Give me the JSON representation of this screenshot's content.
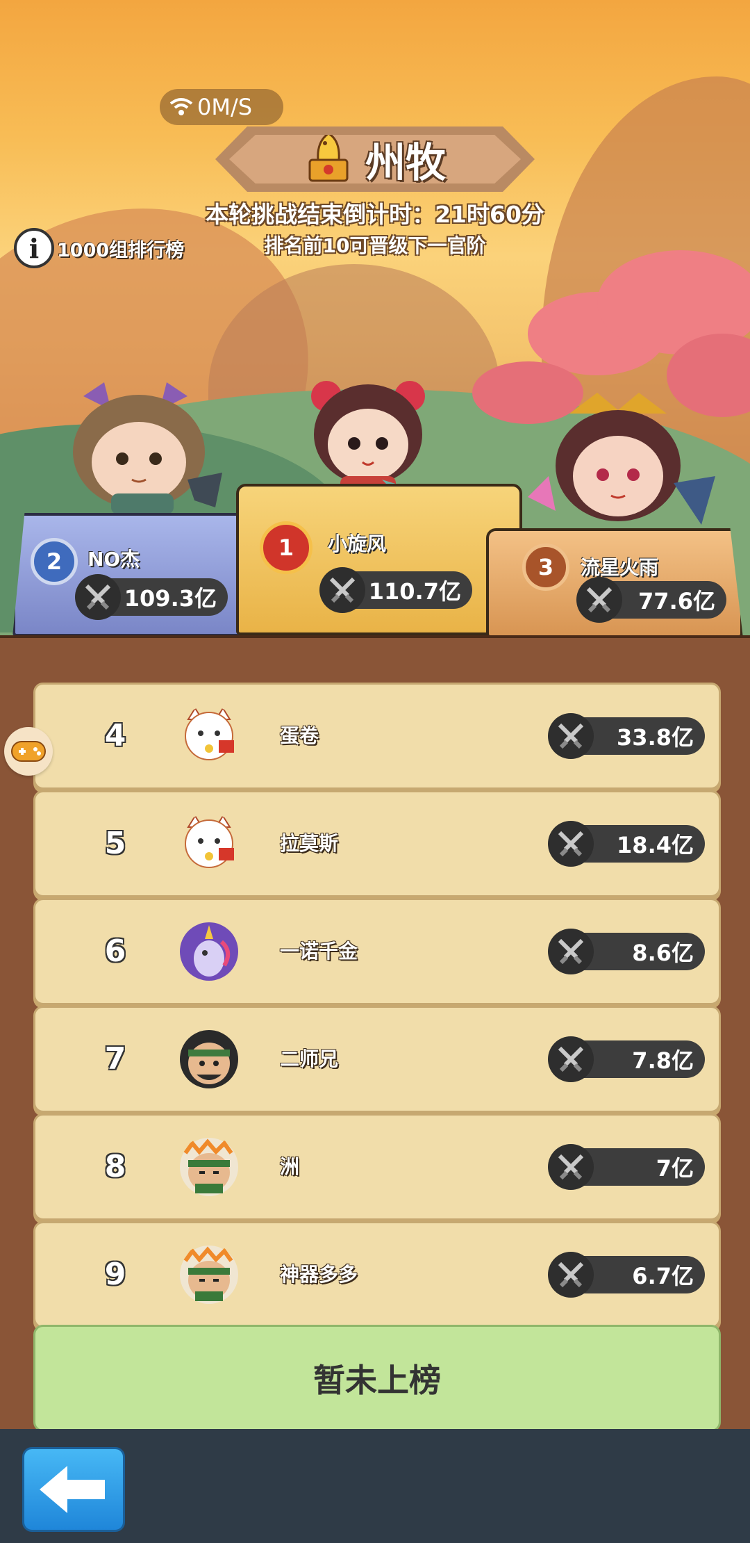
{
  "status": {
    "network_speed": "0M/S"
  },
  "header": {
    "title": "州牧",
    "countdown": "本轮挑战结束倒计时：21时60分",
    "promote_text": "排名前10可晋级下一官阶",
    "leaderboard_link": "1000组排行榜"
  },
  "podium": [
    {
      "rank": "2",
      "name": "NO杰",
      "power": "109.3亿",
      "color": "#7a86c7"
    },
    {
      "rank": "1",
      "name": "小旋风",
      "power": "110.7亿",
      "color": "#e9b347"
    },
    {
      "rank": "3",
      "name": "流星火雨",
      "power": "77.6亿",
      "color": "#d89553"
    }
  ],
  "ranking": [
    {
      "rank": "4",
      "name": "蛋卷",
      "power": "33.8亿",
      "avatar": "cat-avatar-icon"
    },
    {
      "rank": "5",
      "name": "拉莫斯",
      "power": "18.4亿",
      "avatar": "cat-avatar-icon"
    },
    {
      "rank": "6",
      "name": "一诺千金",
      "power": "8.6亿",
      "avatar": "unicorn-avatar-icon"
    },
    {
      "rank": "7",
      "name": "二师兄",
      "power": "7.8亿",
      "avatar": "warrior-avatar-icon"
    },
    {
      "rank": "8",
      "name": "洲",
      "power": "7亿",
      "avatar": "bandana-avatar-icon"
    },
    {
      "rank": "9",
      "name": "神器多多",
      "power": "6.7亿",
      "avatar": "bandana-avatar-icon"
    }
  ],
  "my_status": "暂未上榜",
  "icons": {
    "back": "back-arrow-icon",
    "sword": "crossed-swords-icon",
    "wifi": "wifi-icon",
    "info": "info-icon",
    "gamepad": "gamepad-icon"
  }
}
